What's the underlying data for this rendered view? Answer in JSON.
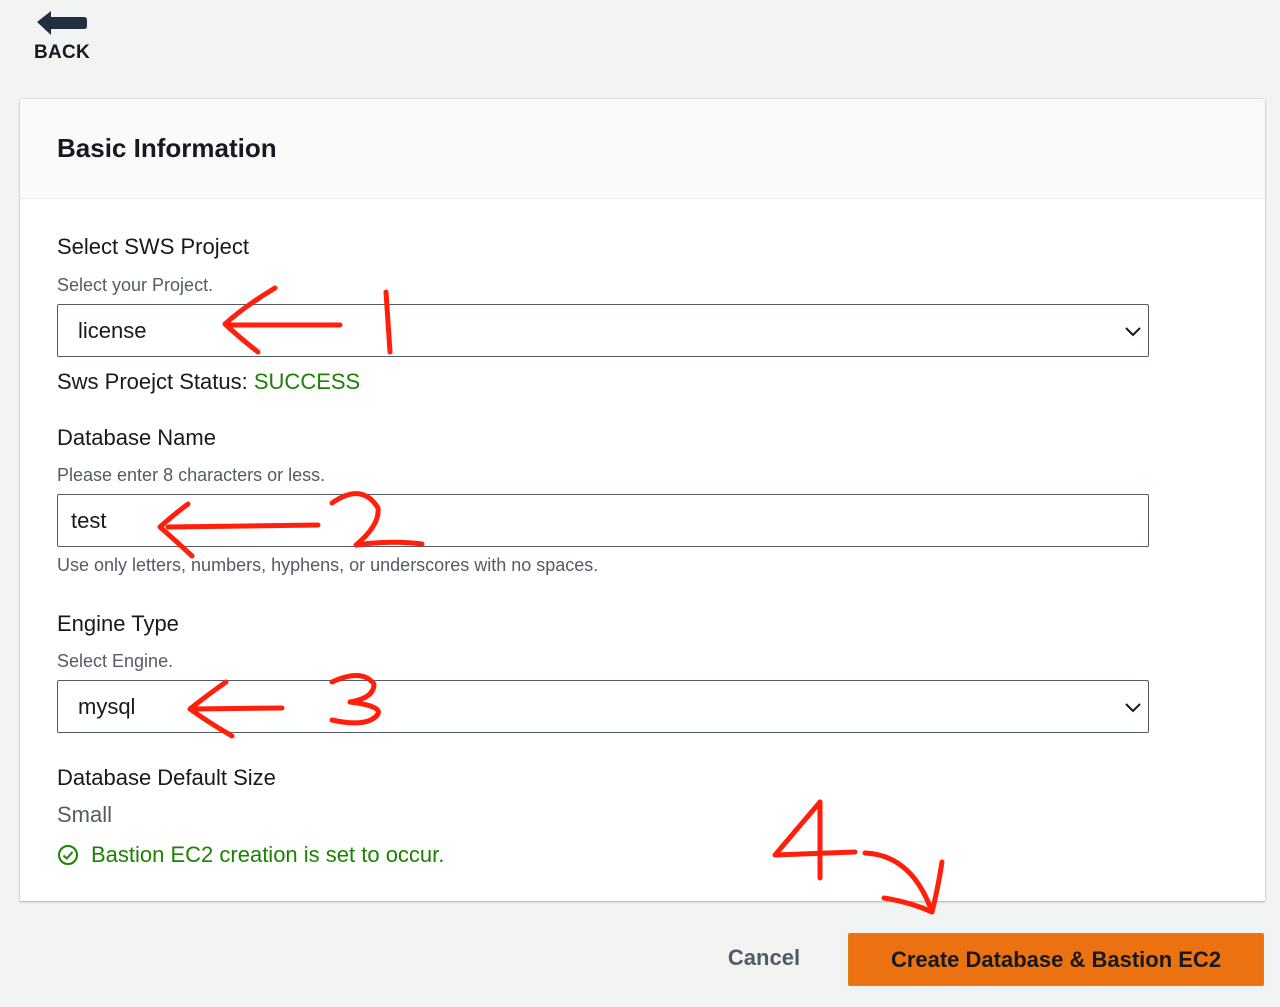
{
  "nav": {
    "back_label": "BACK"
  },
  "panel": {
    "title": "Basic Information"
  },
  "project": {
    "label": "Select SWS Project",
    "description": "Select your Project.",
    "selected": "license",
    "status_label": "Sws Proejct Status:",
    "status_value": "SUCCESS"
  },
  "database_name": {
    "label": "Database Name",
    "description": "Please enter 8 characters or less.",
    "value": "test",
    "constraint": "Use only letters, numbers, hyphens, or underscores with no spaces."
  },
  "engine": {
    "label": "Engine Type",
    "description": "Select Engine.",
    "selected": "mysql"
  },
  "size": {
    "label": "Database Default Size",
    "value": "Small",
    "bastion_notice": "Bastion EC2 creation is set to occur."
  },
  "actions": {
    "cancel_label": "Cancel",
    "create_label": "Create Database & Bastion EC2"
  },
  "colors": {
    "accent": "#ec7211",
    "success": "#1d8102",
    "annotation": "#ff1f0a",
    "background": "#f2f3f3"
  },
  "icons": {
    "back": "back-arrow-icon",
    "select": "chevron-down-icon",
    "notice": "check-circle-icon"
  }
}
